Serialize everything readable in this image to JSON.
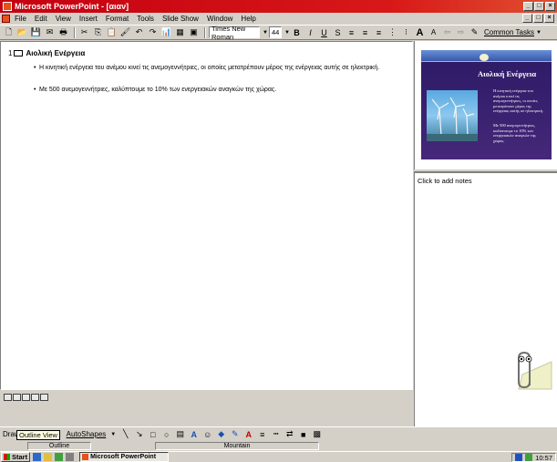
{
  "window": {
    "title": "Microsoft PowerPoint - [αιαν]"
  },
  "menubar": {
    "items": [
      "File",
      "Edit",
      "View",
      "Insert",
      "Format",
      "Tools",
      "Slide Show",
      "Window",
      "Help"
    ]
  },
  "toolbar": {
    "font_name": "Times New Roman",
    "font_size": "44",
    "common_tasks_label": "Common Tasks"
  },
  "outline": {
    "slide_number": "1",
    "slide_title": "Αιολική Ενέργεια",
    "bullets": [
      "Η κινητική ενέργεια του ανέμου κινεί τις ανεμογεννήτριες, οι οποίες μετατρέπουν μέρος της ενέργειας αυτής σε ηλεκτρική.",
      "Με 500 ανεμογεννήτριες, καλύπτουμε το 10% των ενεργειακών αναγκών της χώρας."
    ]
  },
  "preview": {
    "title": "Αιολική Ενέργεια",
    "bullets": [
      "Η κινητική ενέργεια του ανέμου κινεί τις ανεμογεννήτριες, οι οποίες μετατρέπουν μέρος της ενέργειας αυτής σε ηλεκτρική.",
      "Με 500 ανεμογεννήτριες, καλύπτουμε το 10% των ενεργειακών αναγκών της χώρας."
    ]
  },
  "notes": {
    "placeholder": "Click to add notes"
  },
  "drawbar": {
    "draw_label": "Draw",
    "autoshapes_label": "AutoShapes",
    "tooltip": "Outline View"
  },
  "statusbar": {
    "view": "Outline",
    "design": "Mountain"
  },
  "taskbar": {
    "start_label": "Start",
    "task_label": "Microsoft PowerPoint",
    "clock": "10:57"
  },
  "colors": {
    "titlebar": "#c40010",
    "slide_bg": "#2c1a66",
    "chrome": "#d4d0c8"
  }
}
